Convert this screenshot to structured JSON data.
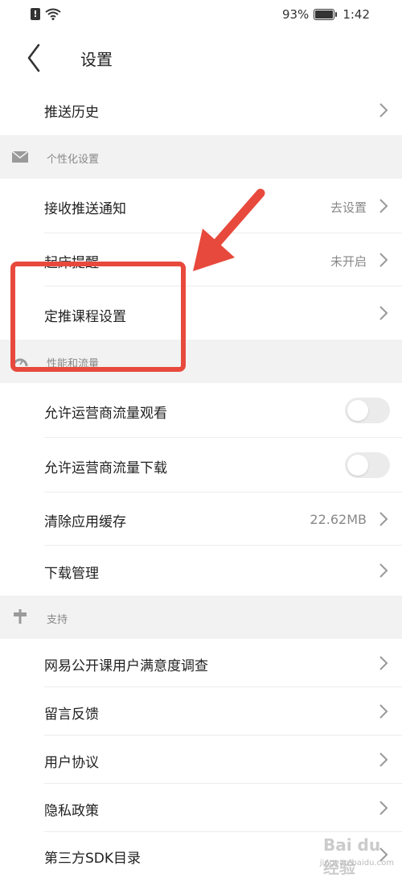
{
  "status_bar": {
    "battery": "93%",
    "time": "1:42"
  },
  "header": {
    "title": "设置"
  },
  "rows": {
    "push_history": "推送历史",
    "receive_push": {
      "label": "接收推送通知",
      "value": "去设置"
    },
    "wake_reminder": {
      "label": "起床提醒",
      "value": "未开启"
    },
    "course_push": "定推课程设置",
    "allow_carrier_watch": "允许运营商流量观看",
    "allow_carrier_download": "允许运营商流量下载",
    "clear_cache": {
      "label": "清除应用缓存",
      "value": "22.62MB"
    },
    "download_mgmt": "下载管理",
    "survey": "网易公开课用户满意度调查",
    "feedback": "留言反馈",
    "user_agreement": "用户协议",
    "privacy": "隐私政策",
    "sdk_list": "第三方SDK目录"
  },
  "sections": {
    "personalization": "个性化设置",
    "performance": "性能和流量",
    "support": "支持"
  },
  "toggles": {
    "carrier_watch_on": false,
    "carrier_download_on": false
  },
  "watermark": {
    "logo": "Bai du 经验",
    "url": "jingyan.baidu.com"
  },
  "colors": {
    "annotation": "#e8493d",
    "section_bg": "#f2f2f2"
  }
}
